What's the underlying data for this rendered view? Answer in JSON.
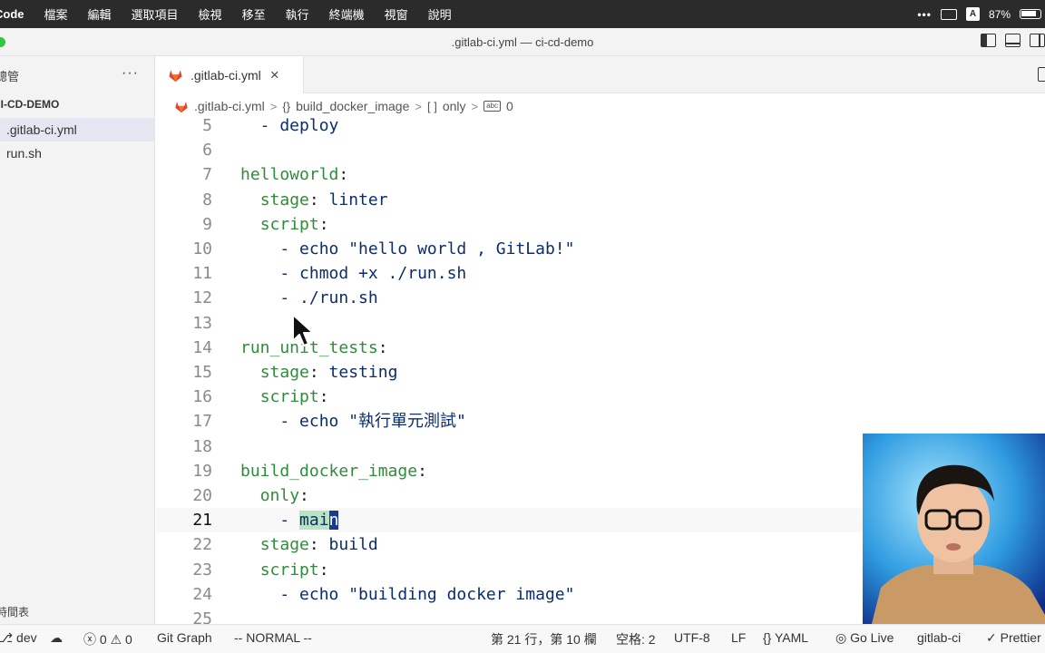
{
  "menubar": {
    "app": "Code",
    "menus": [
      "檔案",
      "編輯",
      "選取項目",
      "檢視",
      "移至",
      "執行",
      "終端機",
      "視窗",
      "說明"
    ],
    "tray": {
      "more": "•••",
      "input": "A",
      "battery": "87%"
    }
  },
  "window": {
    "title": ".gitlab-ci.yml — ci-cd-demo"
  },
  "sidebar": {
    "title": "總管",
    "more": "···",
    "folder": "CI-CD-DEMO",
    "items": [
      {
        "label": ".gitlab-ci.yml",
        "active": true
      },
      {
        "label": "run.sh",
        "active": false
      }
    ],
    "bottom_label": "時間表"
  },
  "tabs": [
    {
      "label": ".gitlab-ci.yml",
      "close": "×"
    }
  ],
  "breadcrumb": {
    "file": ".gitlab-ci.yml",
    "node1_icon": "{}",
    "node1": "build_docker_image",
    "node2_icon": "[ ]",
    "node2": "only",
    "node3_icon": "abc",
    "node3": "0",
    "sep": ">"
  },
  "editor": {
    "current_line": 21,
    "lines": [
      {
        "n": "5",
        "text": "  - deploy"
      },
      {
        "n": "6",
        "text": ""
      },
      {
        "n": "7",
        "text": "helloworld:"
      },
      {
        "n": "8",
        "text": "  stage: linter"
      },
      {
        "n": "9",
        "text": "  script:"
      },
      {
        "n": "10",
        "text": "    - echo \"hello world , GitLab!\""
      },
      {
        "n": "11",
        "text": "    - chmod +x ./run.sh"
      },
      {
        "n": "12",
        "text": "    - ./run.sh"
      },
      {
        "n": "13",
        "text": ""
      },
      {
        "n": "14",
        "text": "run_unit_tests:"
      },
      {
        "n": "15",
        "text": "  stage: testing"
      },
      {
        "n": "16",
        "text": "  script:"
      },
      {
        "n": "17",
        "text": "    - echo \"執行單元測試\""
      },
      {
        "n": "18",
        "text": ""
      },
      {
        "n": "19",
        "text": "build_docker_image:"
      },
      {
        "n": "20",
        "text": "  only:"
      },
      {
        "n": "21",
        "text": "    - main"
      },
      {
        "n": "22",
        "text": "  stage: build"
      },
      {
        "n": "23",
        "text": "  script:"
      },
      {
        "n": "24",
        "text": "    - echo \"building docker image\""
      },
      {
        "n": "25",
        "text": ""
      }
    ]
  },
  "statusbar": {
    "branch": "dev",
    "errors": "0",
    "warnings": "0",
    "git_graph": "Git Graph",
    "mode": "-- NORMAL --",
    "position": "第 21 行，第 10 欄",
    "spaces": "空格: 2",
    "encoding": "UTF-8",
    "eol": "LF",
    "language": "YAML",
    "golive": "Go Live",
    "schema": "gitlab-ci",
    "prettier": "Prettier"
  },
  "colors": {
    "accent": "#1a3a8f",
    "yaml_key": "#2f8c3a",
    "text": "#0b2d6b",
    "menubar": "#2b2b2b"
  }
}
